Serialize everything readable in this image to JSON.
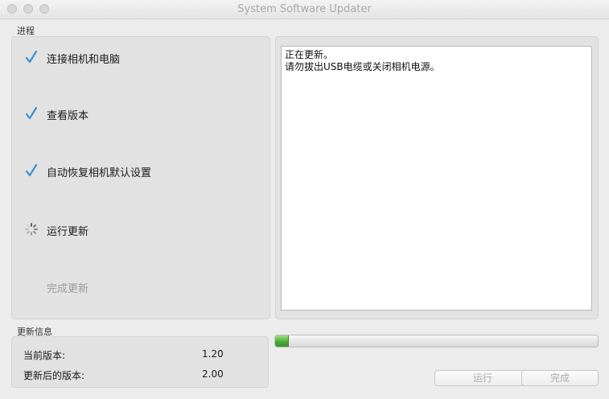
{
  "window": {
    "title": "System Software Updater"
  },
  "progress_section": {
    "label": "进程",
    "steps": [
      {
        "label": "连接相机和电脑",
        "status": "done"
      },
      {
        "label": "查看版本",
        "status": "done"
      },
      {
        "label": "自动恢复相机默认设置",
        "status": "done"
      },
      {
        "label": "运行更新",
        "status": "in-progress"
      },
      {
        "label": "完成更新",
        "status": "pending"
      }
    ]
  },
  "log": {
    "lines": [
      "正在更新。",
      "请勿拔出USB电缆或关闭相机电源。"
    ]
  },
  "info_section": {
    "label": "更新信息",
    "current_version_label": "当前版本:",
    "current_version": "1.20",
    "updated_version_label": "更新后的版本:",
    "updated_version": "2.00"
  },
  "progress_bar": {
    "fraction": 0.04
  },
  "buttons": {
    "run": "运行",
    "done": "完成"
  },
  "colors": {
    "check": "#3c8fd0",
    "progress": "#4aa635"
  }
}
